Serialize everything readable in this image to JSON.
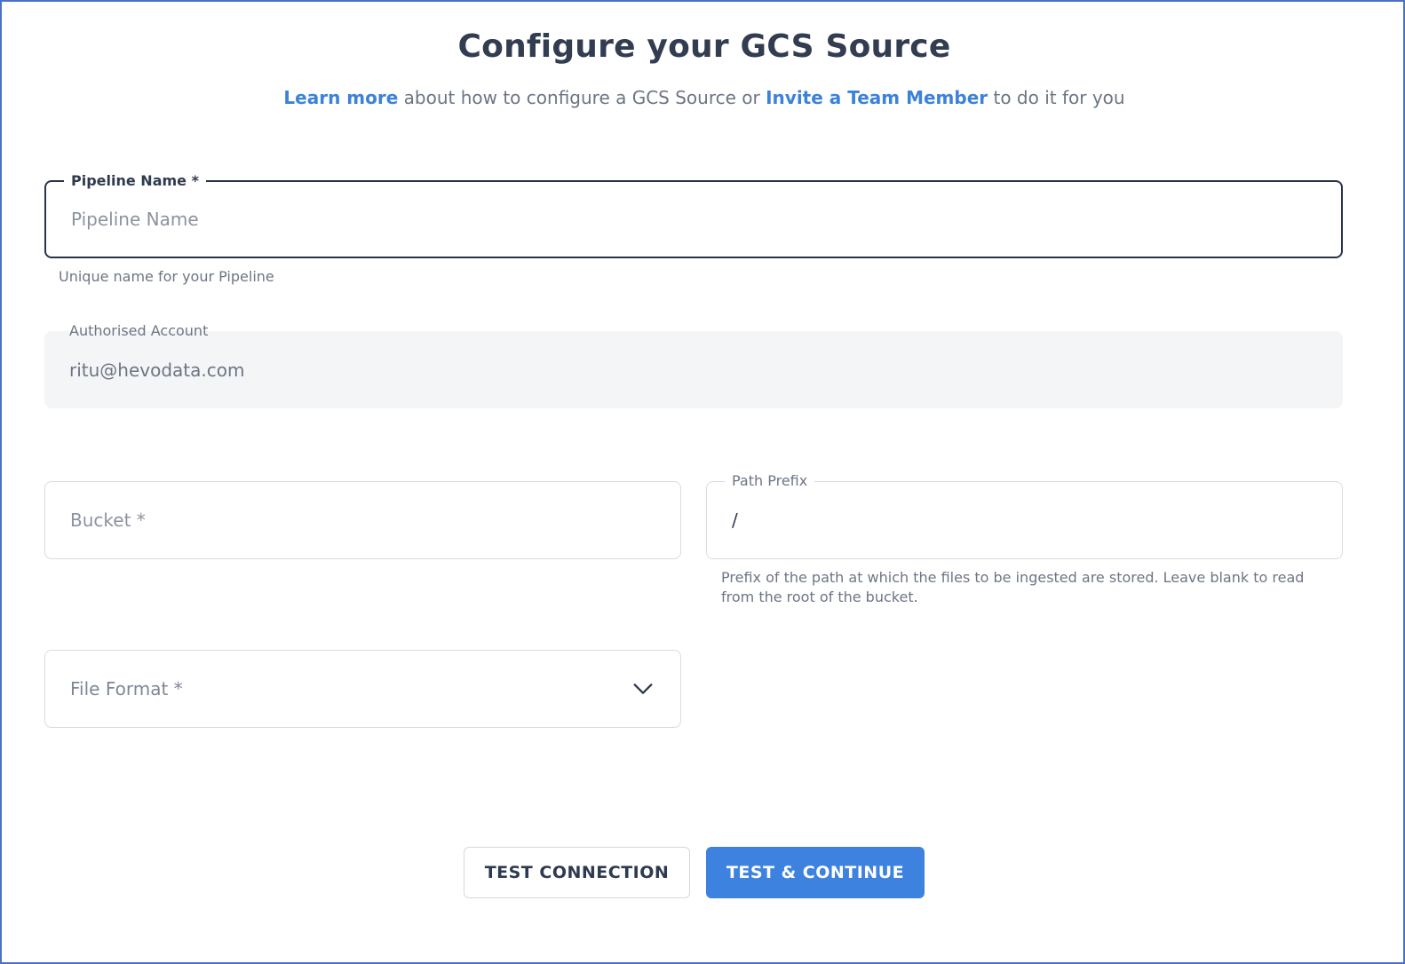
{
  "header": {
    "title": "Configure your GCS Source",
    "learn_more": "Learn more",
    "subtitle_middle": " about how to configure a GCS Source or ",
    "invite_link": "Invite a Team Member",
    "subtitle_end": " to do it for you"
  },
  "form": {
    "pipeline_name": {
      "label": "Pipeline Name *",
      "placeholder": "Pipeline Name",
      "helper": "Unique name for your Pipeline"
    },
    "authorised_account": {
      "label": "Authorised Account",
      "value": "ritu@hevodata.com"
    },
    "bucket": {
      "placeholder": "Bucket *"
    },
    "path_prefix": {
      "label": "Path Prefix",
      "value": "/",
      "helper": "Prefix of the path at which the files to be ingested are stored. Leave blank to read from the root of the bucket."
    },
    "file_format": {
      "placeholder": "File Format *",
      "icon": "chevron-down-icon"
    }
  },
  "actions": {
    "test_connection": "TEST CONNECTION",
    "test_continue": "TEST & CONTINUE"
  },
  "colors": {
    "accent": "#3d82de",
    "link": "#3d82d9",
    "frame_border": "#4a72c4"
  }
}
